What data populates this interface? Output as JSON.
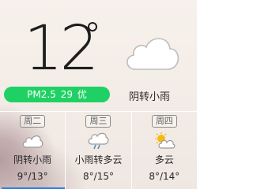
{
  "current": {
    "temperature": "12",
    "condition": "阴转小雨",
    "icon": "cloud-icon"
  },
  "aqi": {
    "label": "PM2.5",
    "value": "29",
    "level": "优",
    "color": "#1fd164"
  },
  "forecast": [
    {
      "day": "周二",
      "condition": "阴转小雨",
      "low": "9°",
      "high": "13°",
      "icon": "cloud-icon"
    },
    {
      "day": "周三",
      "condition": "小雨转多云",
      "low": "8°",
      "high": "15°",
      "icon": "cloud-rain-icon"
    },
    {
      "day": "周四",
      "condition": "多云",
      "low": "8°",
      "high": "14°",
      "icon": "sun-cloud-icon"
    }
  ]
}
